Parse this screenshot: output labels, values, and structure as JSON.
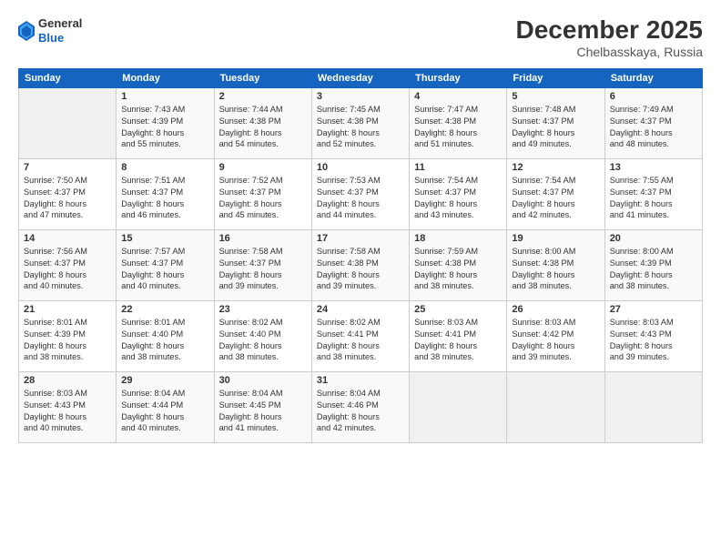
{
  "header": {
    "logo_general": "General",
    "logo_blue": "Blue",
    "month_title": "December 2025",
    "location": "Chelbasskaya, Russia"
  },
  "days_of_week": [
    "Sunday",
    "Monday",
    "Tuesday",
    "Wednesday",
    "Thursday",
    "Friday",
    "Saturday"
  ],
  "weeks": [
    [
      {
        "day": "",
        "data": ""
      },
      {
        "day": "1",
        "data": "Sunrise: 7:43 AM\nSunset: 4:39 PM\nDaylight: 8 hours\nand 55 minutes."
      },
      {
        "day": "2",
        "data": "Sunrise: 7:44 AM\nSunset: 4:38 PM\nDaylight: 8 hours\nand 54 minutes."
      },
      {
        "day": "3",
        "data": "Sunrise: 7:45 AM\nSunset: 4:38 PM\nDaylight: 8 hours\nand 52 minutes."
      },
      {
        "day": "4",
        "data": "Sunrise: 7:47 AM\nSunset: 4:38 PM\nDaylight: 8 hours\nand 51 minutes."
      },
      {
        "day": "5",
        "data": "Sunrise: 7:48 AM\nSunset: 4:37 PM\nDaylight: 8 hours\nand 49 minutes."
      },
      {
        "day": "6",
        "data": "Sunrise: 7:49 AM\nSunset: 4:37 PM\nDaylight: 8 hours\nand 48 minutes."
      }
    ],
    [
      {
        "day": "7",
        "data": "Sunrise: 7:50 AM\nSunset: 4:37 PM\nDaylight: 8 hours\nand 47 minutes."
      },
      {
        "day": "8",
        "data": "Sunrise: 7:51 AM\nSunset: 4:37 PM\nDaylight: 8 hours\nand 46 minutes."
      },
      {
        "day": "9",
        "data": "Sunrise: 7:52 AM\nSunset: 4:37 PM\nDaylight: 8 hours\nand 45 minutes."
      },
      {
        "day": "10",
        "data": "Sunrise: 7:53 AM\nSunset: 4:37 PM\nDaylight: 8 hours\nand 44 minutes."
      },
      {
        "day": "11",
        "data": "Sunrise: 7:54 AM\nSunset: 4:37 PM\nDaylight: 8 hours\nand 43 minutes."
      },
      {
        "day": "12",
        "data": "Sunrise: 7:54 AM\nSunset: 4:37 PM\nDaylight: 8 hours\nand 42 minutes."
      },
      {
        "day": "13",
        "data": "Sunrise: 7:55 AM\nSunset: 4:37 PM\nDaylight: 8 hours\nand 41 minutes."
      }
    ],
    [
      {
        "day": "14",
        "data": "Sunrise: 7:56 AM\nSunset: 4:37 PM\nDaylight: 8 hours\nand 40 minutes."
      },
      {
        "day": "15",
        "data": "Sunrise: 7:57 AM\nSunset: 4:37 PM\nDaylight: 8 hours\nand 40 minutes."
      },
      {
        "day": "16",
        "data": "Sunrise: 7:58 AM\nSunset: 4:37 PM\nDaylight: 8 hours\nand 39 minutes."
      },
      {
        "day": "17",
        "data": "Sunrise: 7:58 AM\nSunset: 4:38 PM\nDaylight: 8 hours\nand 39 minutes."
      },
      {
        "day": "18",
        "data": "Sunrise: 7:59 AM\nSunset: 4:38 PM\nDaylight: 8 hours\nand 38 minutes."
      },
      {
        "day": "19",
        "data": "Sunrise: 8:00 AM\nSunset: 4:38 PM\nDaylight: 8 hours\nand 38 minutes."
      },
      {
        "day": "20",
        "data": "Sunrise: 8:00 AM\nSunset: 4:39 PM\nDaylight: 8 hours\nand 38 minutes."
      }
    ],
    [
      {
        "day": "21",
        "data": "Sunrise: 8:01 AM\nSunset: 4:39 PM\nDaylight: 8 hours\nand 38 minutes."
      },
      {
        "day": "22",
        "data": "Sunrise: 8:01 AM\nSunset: 4:40 PM\nDaylight: 8 hours\nand 38 minutes."
      },
      {
        "day": "23",
        "data": "Sunrise: 8:02 AM\nSunset: 4:40 PM\nDaylight: 8 hours\nand 38 minutes."
      },
      {
        "day": "24",
        "data": "Sunrise: 8:02 AM\nSunset: 4:41 PM\nDaylight: 8 hours\nand 38 minutes."
      },
      {
        "day": "25",
        "data": "Sunrise: 8:03 AM\nSunset: 4:41 PM\nDaylight: 8 hours\nand 38 minutes."
      },
      {
        "day": "26",
        "data": "Sunrise: 8:03 AM\nSunset: 4:42 PM\nDaylight: 8 hours\nand 39 minutes."
      },
      {
        "day": "27",
        "data": "Sunrise: 8:03 AM\nSunset: 4:43 PM\nDaylight: 8 hours\nand 39 minutes."
      }
    ],
    [
      {
        "day": "28",
        "data": "Sunrise: 8:03 AM\nSunset: 4:43 PM\nDaylight: 8 hours\nand 40 minutes."
      },
      {
        "day": "29",
        "data": "Sunrise: 8:04 AM\nSunset: 4:44 PM\nDaylight: 8 hours\nand 40 minutes."
      },
      {
        "day": "30",
        "data": "Sunrise: 8:04 AM\nSunset: 4:45 PM\nDaylight: 8 hours\nand 41 minutes."
      },
      {
        "day": "31",
        "data": "Sunrise: 8:04 AM\nSunset: 4:46 PM\nDaylight: 8 hours\nand 42 minutes."
      },
      {
        "day": "",
        "data": ""
      },
      {
        "day": "",
        "data": ""
      },
      {
        "day": "",
        "data": ""
      }
    ]
  ]
}
